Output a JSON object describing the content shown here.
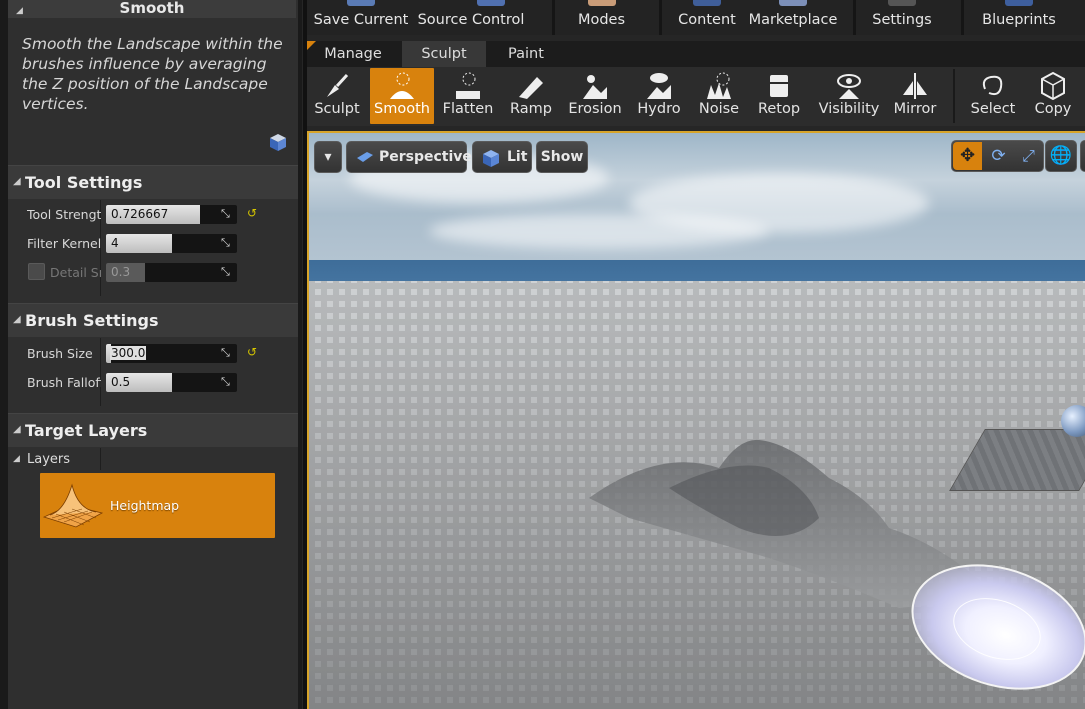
{
  "panel": {
    "header": "Smooth",
    "description": "Smooth the Landscape within the brushes influence by averaging the Z position of the Landscape vertices."
  },
  "tool_settings": {
    "title": "Tool Settings",
    "props": [
      {
        "label": "Tool Strength",
        "value": "0.726667",
        "fill": 0.72,
        "reset": true,
        "enabled": true
      },
      {
        "label": "Filter Kernel Radius",
        "value": "4",
        "fill": 0.5,
        "reset": false,
        "enabled": true
      },
      {
        "label": "Detail Smooth",
        "value": "0.3",
        "fill": 0.3,
        "reset": false,
        "enabled": false
      }
    ]
  },
  "brush_settings": {
    "title": "Brush Settings",
    "props": [
      {
        "label": "Brush Size",
        "value": "300.0",
        "fill": 0.04,
        "reset": true
      },
      {
        "label": "Brush Falloff",
        "value": "0.5",
        "fill": 0.5,
        "reset": false
      }
    ]
  },
  "target_layers": {
    "title": "Target Layers",
    "layers_label": "Layers",
    "layer": "Heightmap"
  },
  "toolbar": {
    "save_current": "Save Current",
    "source_control": "Source Control",
    "modes": "Modes",
    "content": "Content",
    "marketplace": "Marketplace",
    "settings": "Settings",
    "blueprints": "Blueprints"
  },
  "mode_tabs": {
    "manage": "Manage",
    "sculpt": "Sculpt",
    "paint": "Paint",
    "active": "Sculpt"
  },
  "tools": [
    {
      "label": "Sculpt",
      "icon": "sculpt-icon"
    },
    {
      "label": "Smooth",
      "icon": "smooth-icon",
      "active": true
    },
    {
      "label": "Flatten",
      "icon": "flatten-icon"
    },
    {
      "label": "Ramp",
      "icon": "ramp-icon"
    },
    {
      "label": "Erosion",
      "icon": "erosion-icon"
    },
    {
      "label": "Hydro",
      "icon": "hydro-icon"
    },
    {
      "label": "Noise",
      "icon": "noise-icon"
    },
    {
      "label": "Retop",
      "icon": "retop-icon"
    },
    {
      "label": "Visibility",
      "icon": "visibility-icon"
    },
    {
      "label": "Mirror",
      "icon": "mirror-icon"
    },
    {
      "label": "Select",
      "icon": "select-icon"
    },
    {
      "label": "Copy",
      "icon": "copy-icon"
    }
  ],
  "viewport": {
    "perspective": "Perspective",
    "lit": "Lit",
    "show": "Show"
  },
  "colors": {
    "accent": "#d8820d",
    "viewport_border": "#d8a52a"
  }
}
